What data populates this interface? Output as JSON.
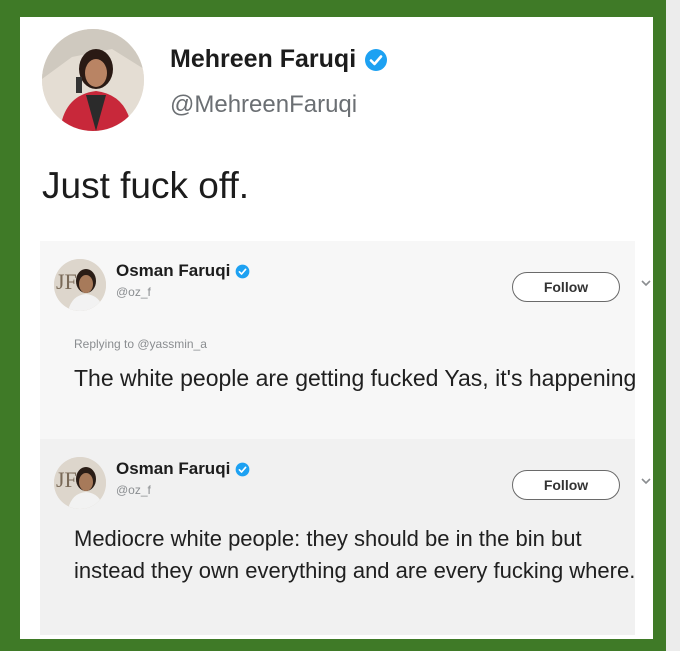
{
  "main_tweet": {
    "author_name": "Mehreen Faruqi",
    "handle": "@MehreenFaruqi",
    "text": "Just fuck off.",
    "verified_color": "#1da1f2"
  },
  "embedded_tweets": [
    {
      "author_name": "Osman Faruqi",
      "handle": "@oz_f",
      "follow_label": "Follow",
      "replying_to": "Replying to @yassmin_a",
      "text": "The white people are getting fucked Yas, it's happening"
    },
    {
      "author_name": "Osman Faruqi",
      "handle": "@oz_f",
      "follow_label": "Follow",
      "text": "Mediocre white people: they should be in the bin but instead they own everything and are every fucking where."
    }
  ],
  "colors": {
    "border": "#3f7a27",
    "verified": "#1da1f2"
  }
}
